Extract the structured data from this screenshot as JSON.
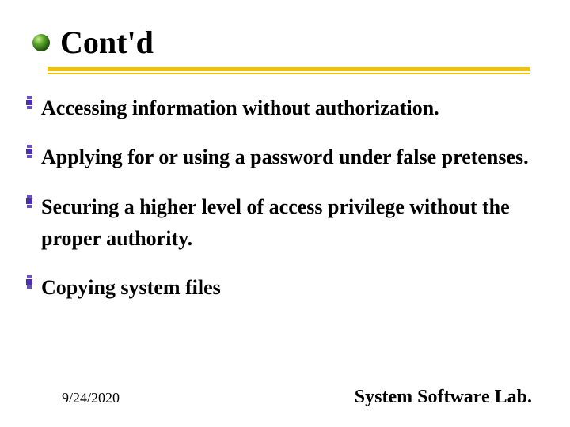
{
  "title": "Cont'd",
  "bullets": [
    "Accessing information without authorization.",
    "Applying for or using a password under false pretenses.",
    " Securing a higher level of access privilege without the proper authority.",
    " Copying system files"
  ],
  "footer": {
    "date": "9/24/2020",
    "org": "System Software Lab."
  }
}
